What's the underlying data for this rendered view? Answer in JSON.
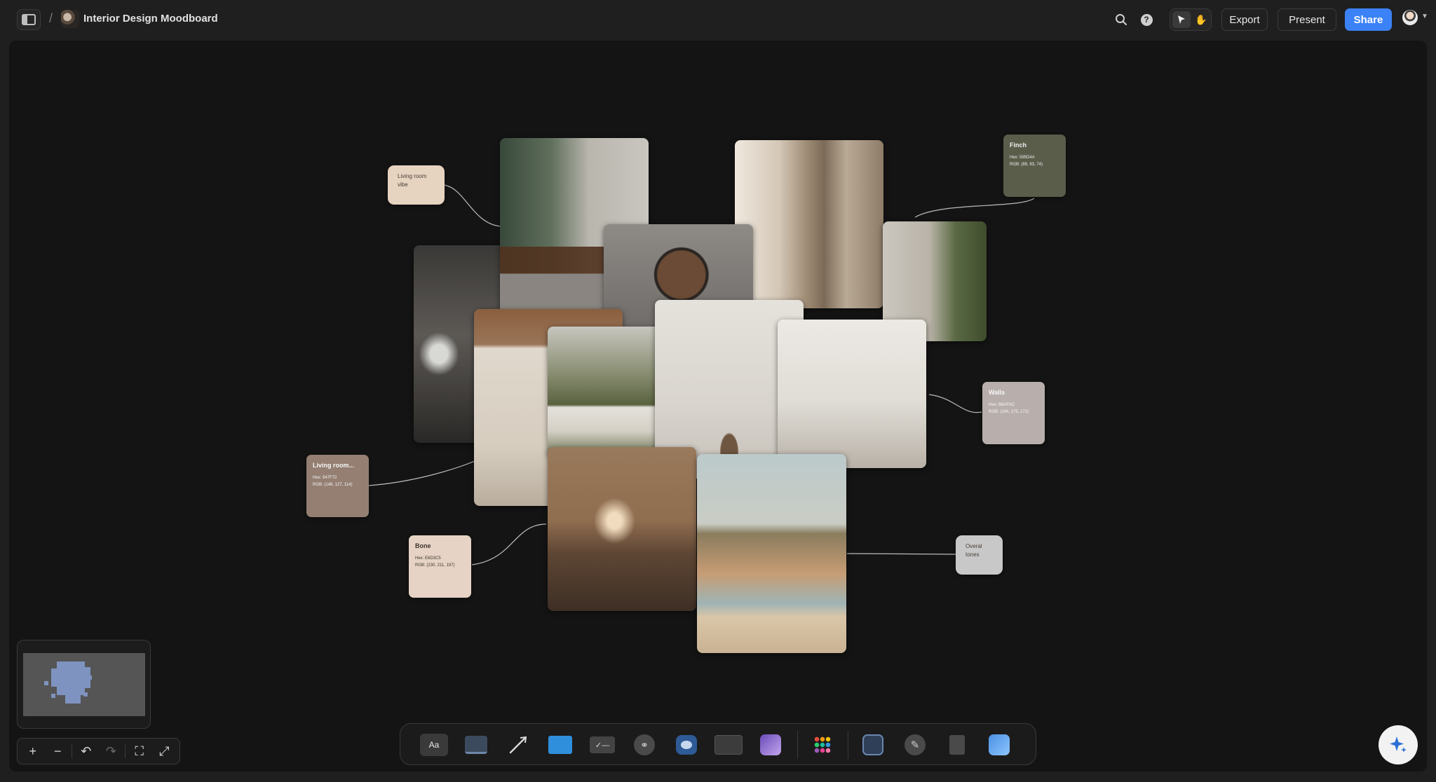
{
  "header": {
    "board_title": "Interior Design Moodboard",
    "breadcrumb_sep": "/",
    "export_label": "Export",
    "present_label": "Present",
    "share_label": "Share"
  },
  "canvas": {
    "notes": [
      {
        "text_line1": "Living room",
        "text_line2": "vibe",
        "color": "#e6d3c0"
      },
      {
        "text_line1": "Overal",
        "text_line2": "tones",
        "color": "#c8c8c8"
      }
    ],
    "swatches": [
      {
        "name": "Finch",
        "hex": "Hex: 595D4A",
        "rgb": "RGB: (89, 93, 74)",
        "color": "#595d4a",
        "text_color": "#f0f0f0"
      },
      {
        "name": "Walls",
        "hex": "Hex: B8AFAC",
        "rgb": "RGB: (184, 175, 172)",
        "color": "#b8afac",
        "text_color": "#f6f6f6"
      },
      {
        "name": "Living room...",
        "hex": "Hex: 947F72",
        "rgb": "RGB: (148, 127, 114)",
        "color": "#947f72",
        "text_color": "#f6f6f6"
      },
      {
        "name": "Bone",
        "hex": "Hex: E6D3C5",
        "rgb": "RGB: (230, 211, 197)",
        "color": "#e6d3c5",
        "text_color": "#3d342e"
      }
    ]
  },
  "zoom_controls": {
    "zoom_in": "+",
    "zoom_out": "−",
    "undo": "↶",
    "redo": "↷",
    "crop": "⛶",
    "fullscreen": "⤢"
  },
  "toolbar": {
    "text_tool_label": "Aa"
  },
  "icons": [
    "sidebar-icon",
    "search-icon",
    "help-icon",
    "cursor-icon",
    "hand-icon",
    "sparkle-icon"
  ]
}
